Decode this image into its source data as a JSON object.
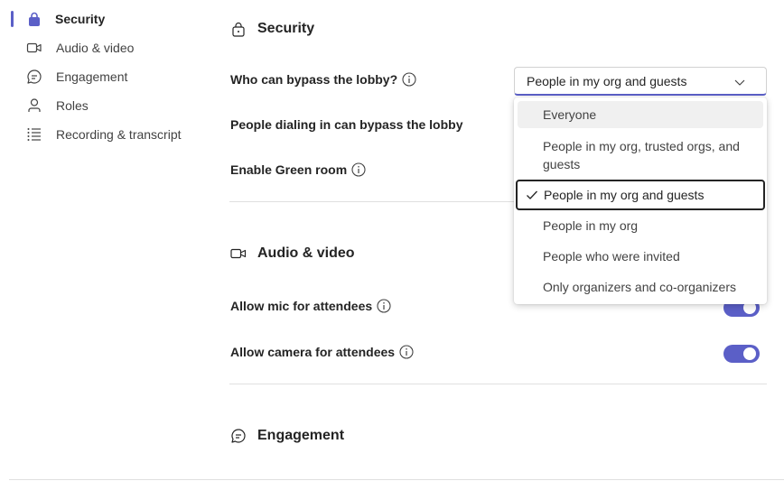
{
  "sidebar": {
    "items": [
      {
        "label": "Security",
        "icon": "lock-icon",
        "active": true
      },
      {
        "label": "Audio & video",
        "icon": "video-camera-icon"
      },
      {
        "label": "Engagement",
        "icon": "chat-bubble-icon"
      },
      {
        "label": "Roles",
        "icon": "person-icon"
      },
      {
        "label": "Recording & transcript",
        "icon": "list-icon"
      }
    ]
  },
  "sections": {
    "security": {
      "title": "Security",
      "lobby_label": "Who can bypass the lobby?",
      "dialin_label": "People dialing in can bypass the lobby",
      "greenroom_label": "Enable Green room"
    },
    "audio_video": {
      "title": "Audio & video",
      "mic_label": "Allow mic for attendees",
      "camera_label": "Allow camera for attendees",
      "mic_on": true,
      "camera_on": true
    },
    "engagement": {
      "title": "Engagement"
    }
  },
  "lobby_dropdown": {
    "selected": "People in my org and guests",
    "options": [
      "Everyone",
      "People in my org, trusted orgs, and guests",
      "People in my org and guests",
      "People in my org",
      "People who were invited",
      "Only organizers and co-organizers"
    ]
  },
  "colors": {
    "accent": "#5b5fc7",
    "text": "#242424",
    "divider": "#e0e0e0"
  }
}
